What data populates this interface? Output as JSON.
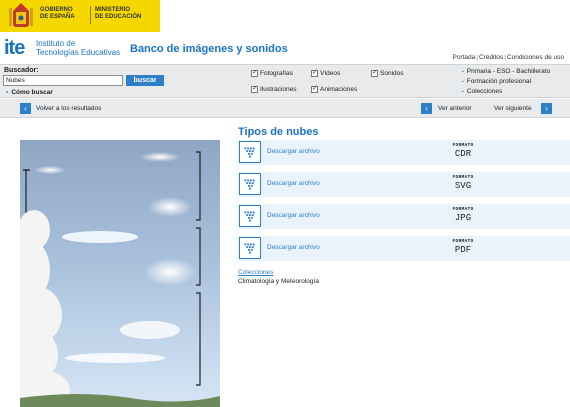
{
  "government": {
    "line1": "Gobierno",
    "line2": "de España",
    "ministry1": "Ministerio",
    "ministry2": "de Educación"
  },
  "ite": {
    "logo": "ite",
    "subtitle1": "Instituto de",
    "subtitle2": "Tecnologías Educativas",
    "site_title": "Banco de imágenes y sonidos"
  },
  "top_links": [
    "Portada",
    "Créditos",
    "Condiciones de uso"
  ],
  "search": {
    "label": "Buscador:",
    "value": "Nubes",
    "button": "buscar",
    "how_to": "Cómo buscar"
  },
  "filters": [
    {
      "label": "Fotografías",
      "checked": true
    },
    {
      "label": "Ilustraciones",
      "checked": true
    },
    {
      "label": "Vídeos",
      "checked": true
    },
    {
      "label": "Animaciones",
      "checked": true
    },
    {
      "label": "Sonidos",
      "checked": true
    }
  ],
  "levels": [
    "Primaria - ESO - Bachillerato",
    "Formación profesional",
    "Colecciones"
  ],
  "nav": {
    "back": "Volver a los resultados",
    "prev": "Ver anterior",
    "next": "Ver siguiente"
  },
  "item": {
    "title": "Tipos de nubes"
  },
  "downloads": [
    {
      "label": "Descargar archivo",
      "format_label": "FORMATO",
      "format": "CDR"
    },
    {
      "label": "Descargar archivo",
      "format_label": "FORMATO",
      "format": "SVG"
    },
    {
      "label": "Descargar archivo",
      "format_label": "FORMATO",
      "format": "JPG"
    },
    {
      "label": "Descargar archivo",
      "format_label": "FORMATO",
      "format": "PDF"
    }
  ],
  "collections": {
    "link": "Colecciones",
    "item": "Climatología y Meteorología"
  },
  "colors": {
    "accent": "#2d7fc7",
    "gov_yellow": "#f5d800",
    "sky_top": "#8fa7c4",
    "sky_bottom": "#cfe0f2"
  }
}
